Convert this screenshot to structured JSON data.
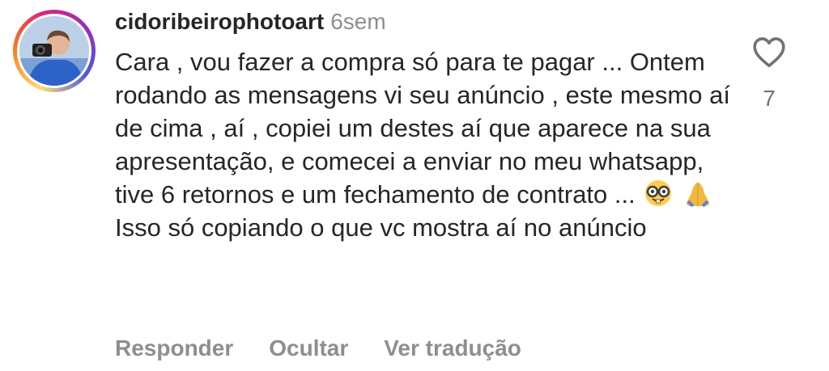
{
  "comment": {
    "username": "cidoribeirophotoart",
    "time": "6sem",
    "text_before_emojis": "Cara , vou fazer a compra só para te pagar ... Ontem rodando as mensagens vi seu anúncio , este mesmo aí de cima , aí , copiei um destes aí que aparece na sua apresentação, e comecei a enviar no meu whatsapp, tive 6 retornos e um fechamento de contrato ...",
    "text_after_emojis": " Isso só copiando o que vc mostra aí no anúncio",
    "emojis": [
      "nerd-face-emoji",
      "folded-hands-emoji"
    ],
    "like_icon": "heart-outline-icon",
    "like_count": "7"
  },
  "actions": {
    "reply": "Responder",
    "hide": "Ocultar",
    "translate": "Ver tradução"
  },
  "colors": {
    "text": "#262626",
    "muted": "#8e8e8e",
    "count": "#737373",
    "story_ring": [
      "#feda75",
      "#fa7e1e",
      "#d62976",
      "#962fbf",
      "#4f5bd5"
    ]
  }
}
